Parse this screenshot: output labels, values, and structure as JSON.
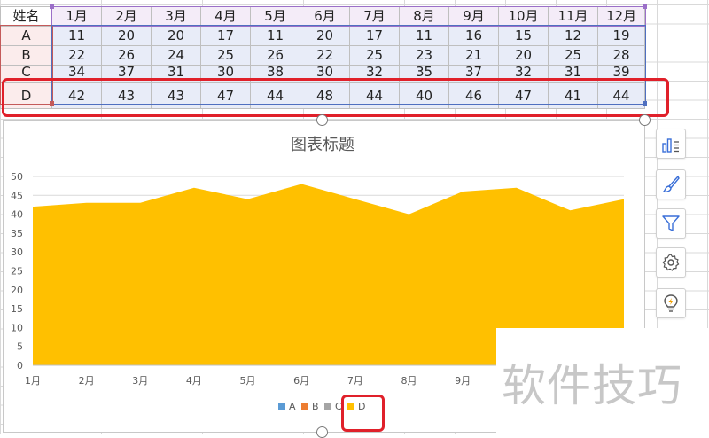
{
  "table": {
    "header": [
      "姓名",
      "1月",
      "2月",
      "3月",
      "4月",
      "5月",
      "6月",
      "7月",
      "8月",
      "9月",
      "10月",
      "11月",
      "12月"
    ],
    "rows": [
      {
        "name": "A",
        "values": [
          11,
          20,
          20,
          17,
          11,
          20,
          17,
          11,
          16,
          15,
          12,
          19
        ]
      },
      {
        "name": "B",
        "values": [
          22,
          26,
          24,
          25,
          26,
          22,
          25,
          23,
          21,
          20,
          25,
          28
        ]
      },
      {
        "name": "C",
        "values": [
          34,
          37,
          31,
          30,
          38,
          30,
          32,
          35,
          37,
          32,
          31,
          39
        ]
      },
      {
        "name": "D",
        "values": [
          42,
          43,
          43,
          47,
          44,
          48,
          44,
          40,
          46,
          47,
          41,
          44
        ]
      }
    ]
  },
  "chart_data": {
    "type": "area",
    "title": "图表标题",
    "categories": [
      "1月",
      "2月",
      "3月",
      "4月",
      "5月",
      "6月",
      "7月",
      "8月",
      "9月"
    ],
    "series": [
      {
        "name": "D",
        "values": [
          42,
          43,
          43,
          47,
          44,
          48,
          44,
          40,
          46,
          47,
          41,
          44
        ],
        "color": "#ffc000"
      }
    ],
    "legend": [
      {
        "name": "A",
        "color": "#5b9bd5"
      },
      {
        "name": "B",
        "color": "#ed7d31"
      },
      {
        "name": "C",
        "color": "#a5a5a5"
      },
      {
        "name": "D",
        "color": "#ffc000"
      }
    ],
    "yticks": [
      "0",
      "5",
      "10",
      "15",
      "20",
      "25",
      "30",
      "35",
      "40",
      "45",
      "50"
    ],
    "ylim": [
      0,
      50
    ],
    "grid": true,
    "legend_position": "bottom",
    "xlabel": "",
    "ylabel": ""
  },
  "side_tools": [
    {
      "icon": "chart-elements-icon"
    },
    {
      "icon": "chart-style-brush-icon"
    },
    {
      "icon": "chart-filter-icon"
    },
    {
      "icon": "chart-settings-gear-icon"
    },
    {
      "icon": "chart-tips-lightbulb-icon"
    }
  ],
  "watermark": {
    "text": "软件技巧"
  },
  "colors": {
    "highlight": "#e0202a",
    "area": "#ffc000",
    "header_fill": "#f4ecf8",
    "name_fill": "#fbecec",
    "value_fill": "#e8ecf8"
  }
}
